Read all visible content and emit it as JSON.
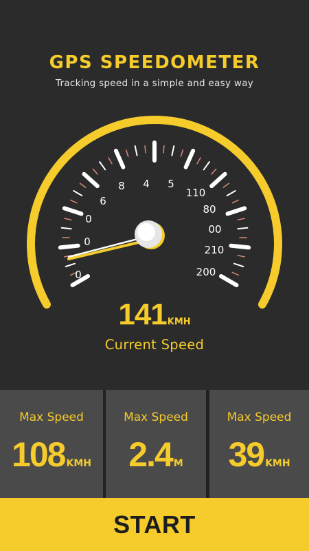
{
  "header": {
    "title": "GPS SPEEDOMETER",
    "subtitle": "Tracking speed in a simple and easy way"
  },
  "gauge": {
    "left_labels": [
      "0",
      "0",
      "0",
      "6",
      "8"
    ],
    "top_labels": [
      "4",
      "5"
    ],
    "right_labels": [
      "110",
      "80",
      "00",
      "210",
      "200"
    ],
    "needle_value_label": "0"
  },
  "current_speed": {
    "value": "141",
    "unit": "KMH",
    "label": "Current Speed"
  },
  "stats": [
    {
      "label": "Max Speed",
      "value": "108",
      "unit": "KMH"
    },
    {
      "label": "Max Speed",
      "value": "2.4",
      "unit": "M"
    },
    {
      "label": "Max Speed",
      "value": "39",
      "unit": "KMH"
    }
  ],
  "start_button": {
    "label": "START"
  },
  "colors": {
    "accent": "#f6cc2c",
    "background": "#2b2b2b",
    "card": "#4a4a4a",
    "divider": "#222222",
    "tick_red": "#d98a7a"
  }
}
